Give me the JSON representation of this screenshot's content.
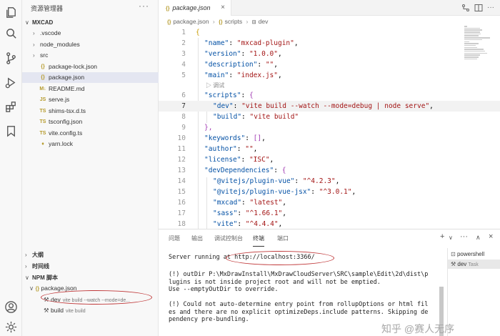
{
  "explorer": {
    "title": "资源管理器",
    "more": "···",
    "root": "MXCAD",
    "items": [
      {
        "name": ".vscode",
        "type": "folder",
        "icon": ""
      },
      {
        "name": "node_modules",
        "type": "folder",
        "icon": ""
      },
      {
        "name": "src",
        "type": "folder",
        "icon": ""
      },
      {
        "name": "package-lock.json",
        "type": "file",
        "icon": "{}"
      },
      {
        "name": "package.json",
        "type": "file",
        "icon": "{}",
        "selected": true
      },
      {
        "name": "README.md",
        "type": "file",
        "icon": "M↓"
      },
      {
        "name": "serve.js",
        "type": "file",
        "icon": "JS"
      },
      {
        "name": "shims-tsx.d.ts",
        "type": "file",
        "icon": "TS"
      },
      {
        "name": "tsconfig.json",
        "type": "file",
        "icon": "TS"
      },
      {
        "name": "vite.config.ts",
        "type": "file",
        "icon": "TS"
      },
      {
        "name": "yarn.lock",
        "type": "file",
        "icon": "♦"
      }
    ],
    "outline": "大纲",
    "timeline": "时间线",
    "npm_scripts": "NPM 脚本",
    "npm_file": "package.json",
    "npm_items": [
      {
        "name": "dev",
        "cmd": "vite build --watch --mode=de..."
      },
      {
        "name": "build",
        "cmd": "vite build"
      }
    ]
  },
  "editor": {
    "tab": {
      "icon": "{}",
      "title": "package.json",
      "close": "×"
    },
    "breadcrumbs": [
      {
        "icon": "{}",
        "label": "package.json"
      },
      {
        "icon": "{}",
        "label": "scripts"
      },
      {
        "icon": "⊡",
        "label": "dev"
      }
    ],
    "codelens": "▷ 调试",
    "lines": [
      {
        "n": "1",
        "text": "{"
      },
      {
        "n": "2",
        "key": "\"name\"",
        "value": "\"mxcad-plugin\""
      },
      {
        "n": "3",
        "key": "\"version\"",
        "value": "\"1.0.0\""
      },
      {
        "n": "4",
        "key": "\"description\"",
        "value": "\"\""
      },
      {
        "n": "5",
        "key": "\"main\"",
        "value": "\"index.js\""
      },
      {
        "n": "6",
        "key": "\"scripts\"",
        "value": "{"
      },
      {
        "n": "7",
        "key": "\"dev\"",
        "value": "\"vite build --watch --mode=debug | node serve\""
      },
      {
        "n": "8",
        "key": "\"build\"",
        "value": "\"vite build\""
      },
      {
        "n": "9",
        "text": "},"
      },
      {
        "n": "10",
        "key": "\"keywords\"",
        "value": "[]"
      },
      {
        "n": "11",
        "key": "\"author\"",
        "value": "\"\""
      },
      {
        "n": "12",
        "key": "\"license\"",
        "value": "\"ISC\""
      },
      {
        "n": "13",
        "key": "\"devDependencies\"",
        "value": "{"
      },
      {
        "n": "14",
        "key": "\"@vitejs/plugin-vue\"",
        "value": "\"^4.2.3\""
      },
      {
        "n": "15",
        "key": "\"@vitejs/plugin-vue-jsx\"",
        "value": "\"^3.0.1\""
      },
      {
        "n": "16",
        "key": "\"mxcad\"",
        "value": "\"latest\""
      },
      {
        "n": "17",
        "key": "\"sass\"",
        "value": "\"^1.66.1\""
      },
      {
        "n": "18",
        "key": "\"vite\"",
        "value": "\"^4.4.4\""
      }
    ]
  },
  "panel": {
    "tabs": [
      "问题",
      "输出",
      "调试控制台",
      "终端",
      "端口"
    ],
    "active_tab": "终端",
    "actions": [
      "+",
      "∨",
      "···",
      "∧",
      "×"
    ],
    "terminal_lines": [
      "Server running at http://localhost:3366/",
      "",
      "(!) outDir P:\\MxDrawInstall\\MxDrawCloudServer\\SRC\\sample\\Edit\\2d\\dist\\p",
      "lugins is not inside project root and will not be emptied.",
      "Use --emptyOutDir to override.",
      "",
      "(!) Could not auto-determine entry point from rollupOptions or html fil",
      "es and there are no explicit optimizeDeps.include patterns. Skipping de",
      "pendency pre-bundling."
    ],
    "terminals": [
      {
        "name": "powershell",
        "task": ""
      },
      {
        "name": "dev",
        "task": "Task"
      }
    ]
  },
  "watermark": "知乎 @赛人无序",
  "colors": {
    "key": "#0451a5",
    "string": "#a31515",
    "annotation": "#c0393a",
    "selection": "#e4e6f1"
  }
}
